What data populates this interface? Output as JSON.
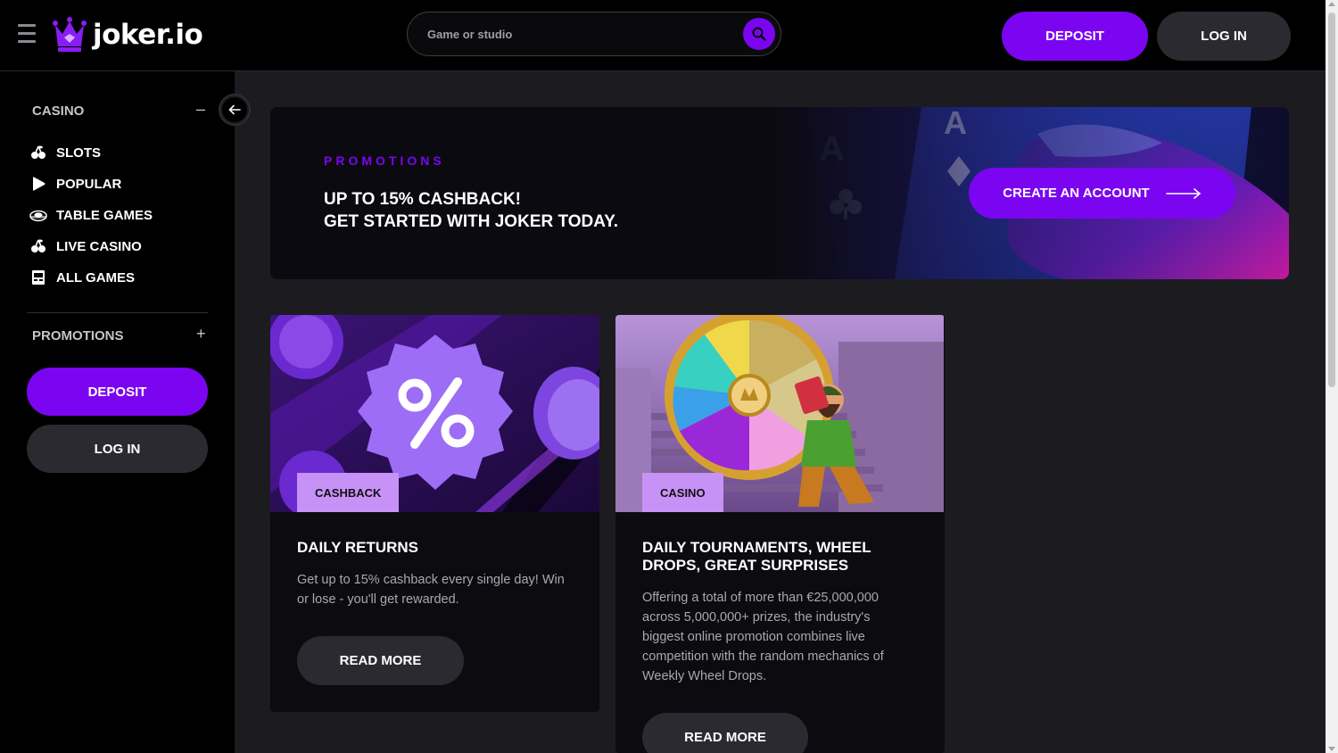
{
  "header": {
    "logo_text": "joker.io",
    "search_placeholder": "Game or studio",
    "deposit_label": "DEPOSIT",
    "login_label": "LOG IN"
  },
  "sidebar": {
    "casino_title": "CASINO",
    "casino_toggle": "–",
    "items": [
      {
        "label": "SLOTS",
        "icon": "cherries-icon"
      },
      {
        "label": "POPULAR",
        "icon": "play-icon"
      },
      {
        "label": "TABLE GAMES",
        "icon": "roulette-icon"
      },
      {
        "label": "LIVE CASINO",
        "icon": "cherries-icon"
      },
      {
        "label": "ALL GAMES",
        "icon": "slot-machine-icon"
      }
    ],
    "promotions_title": "PROMOTIONS",
    "promotions_toggle": "+",
    "deposit_label": "DEPOSIT",
    "login_label": "LOG IN"
  },
  "banner": {
    "eyebrow": "PROMOTIONS",
    "line1": "UP TO 15% CASHBACK!",
    "line2": "GET STARTED WITH JOKER TODAY.",
    "cta_label": "CREATE AN ACCOUNT"
  },
  "cards": [
    {
      "tag": "CASHBACK",
      "title": "DAILY RETURNS",
      "description": "Get up to 15% cashback every single day! Win or lose - you'll get rewarded.",
      "button_label": "READ MORE"
    },
    {
      "tag": "CASINO",
      "title": "DAILY TOURNAMENTS, WHEEL DROPS, GREAT SURPRISES",
      "description": "Offering a total of more than €25,000,000 across 5,000,000+ prizes, the industry's biggest online promotion combines live competition with the random mechanics of Weekly Wheel Drops.",
      "button_label": "READ MORE"
    }
  ],
  "colors": {
    "accent": "#7b05f0",
    "tag_bg": "#c792f5",
    "surface": "#1c1b20",
    "sidebar_bg": "#000000"
  }
}
